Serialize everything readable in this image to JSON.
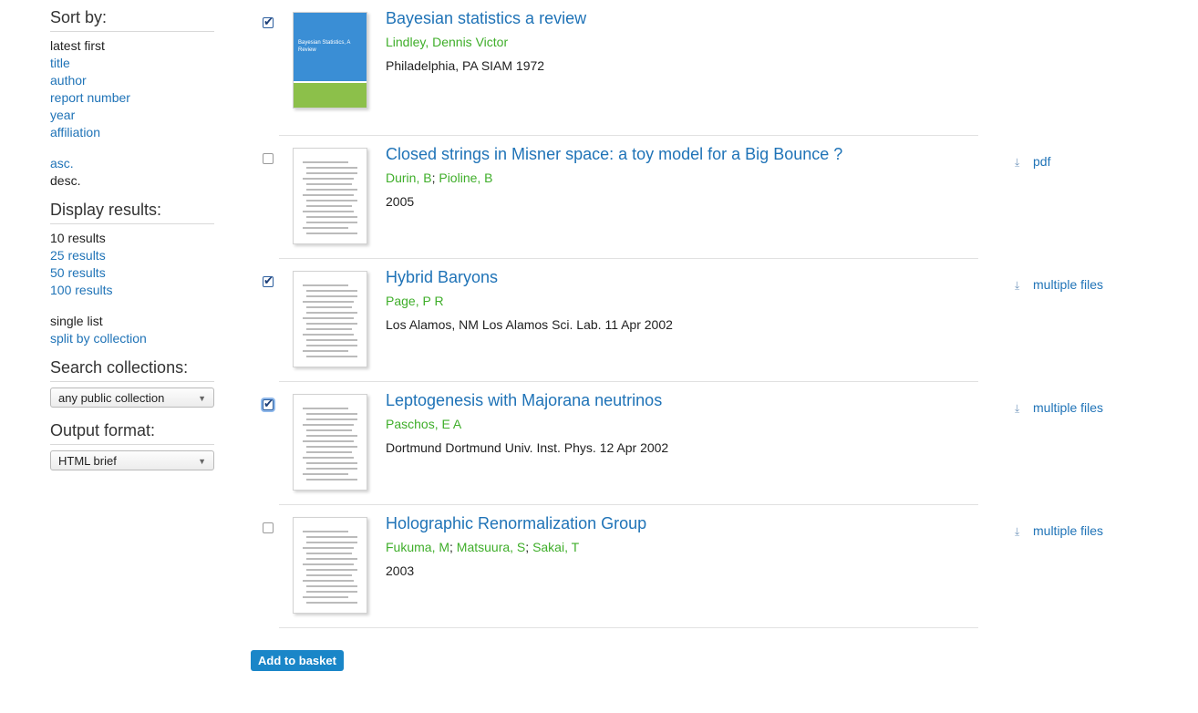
{
  "sidebar": {
    "sort_heading": "Sort by:",
    "sort_options": [
      "latest first",
      "title",
      "author",
      "report number",
      "year",
      "affiliation"
    ],
    "sort_active": "latest first",
    "order_options": [
      "asc.",
      "desc."
    ],
    "order_active": "desc.",
    "display_heading": "Display results:",
    "display_options": [
      "10 results",
      "25 results",
      "50 results",
      "100 results"
    ],
    "display_active": "10 results",
    "list_options": [
      "single list",
      "split by collection"
    ],
    "list_active": "single list",
    "collections_heading": "Search collections:",
    "collections_value": "any public collection",
    "output_heading": "Output format:",
    "output_value": "HTML brief"
  },
  "results": [
    {
      "checked": true,
      "title": "Bayesian statistics a review",
      "authors": [
        "Lindley, Dennis Victor"
      ],
      "pub": "Philadelphia, PA SIAM 1972",
      "files": "",
      "thumb": "cover"
    },
    {
      "checked": false,
      "title": "Closed strings in Misner space: a toy model for a Big Bounce ?",
      "authors": [
        "Durin, B",
        "Pioline, B"
      ],
      "pub": "2005",
      "files": "pdf",
      "thumb": "paper"
    },
    {
      "checked": true,
      "title": "Hybrid Baryons",
      "authors": [
        "Page, P R"
      ],
      "pub": "Los Alamos, NM Los Alamos Sci. Lab. 11 Apr 2002",
      "files": "multiple files",
      "thumb": "paper"
    },
    {
      "checked": true,
      "focus": true,
      "title": "Leptogenesis with Majorana neutrinos",
      "authors": [
        "Paschos, E A"
      ],
      "pub": "Dortmund Dortmund Univ. Inst. Phys. 12 Apr 2002",
      "files": "multiple files",
      "thumb": "paper"
    },
    {
      "checked": false,
      "title": "Holographic Renormalization Group",
      "authors": [
        "Fukuma, M",
        "Matsuura, S",
        "Sakai, T"
      ],
      "pub": "2003",
      "files": "multiple files",
      "thumb": "paper"
    }
  ],
  "basket_label": "Add to basket",
  "cover_text": "Bayesian Statistics, A Review",
  "icons": {
    "download": "download-icon"
  },
  "colors": {
    "link": "#1f73b7",
    "author": "#3fae2a",
    "button": "#1a86c8"
  }
}
